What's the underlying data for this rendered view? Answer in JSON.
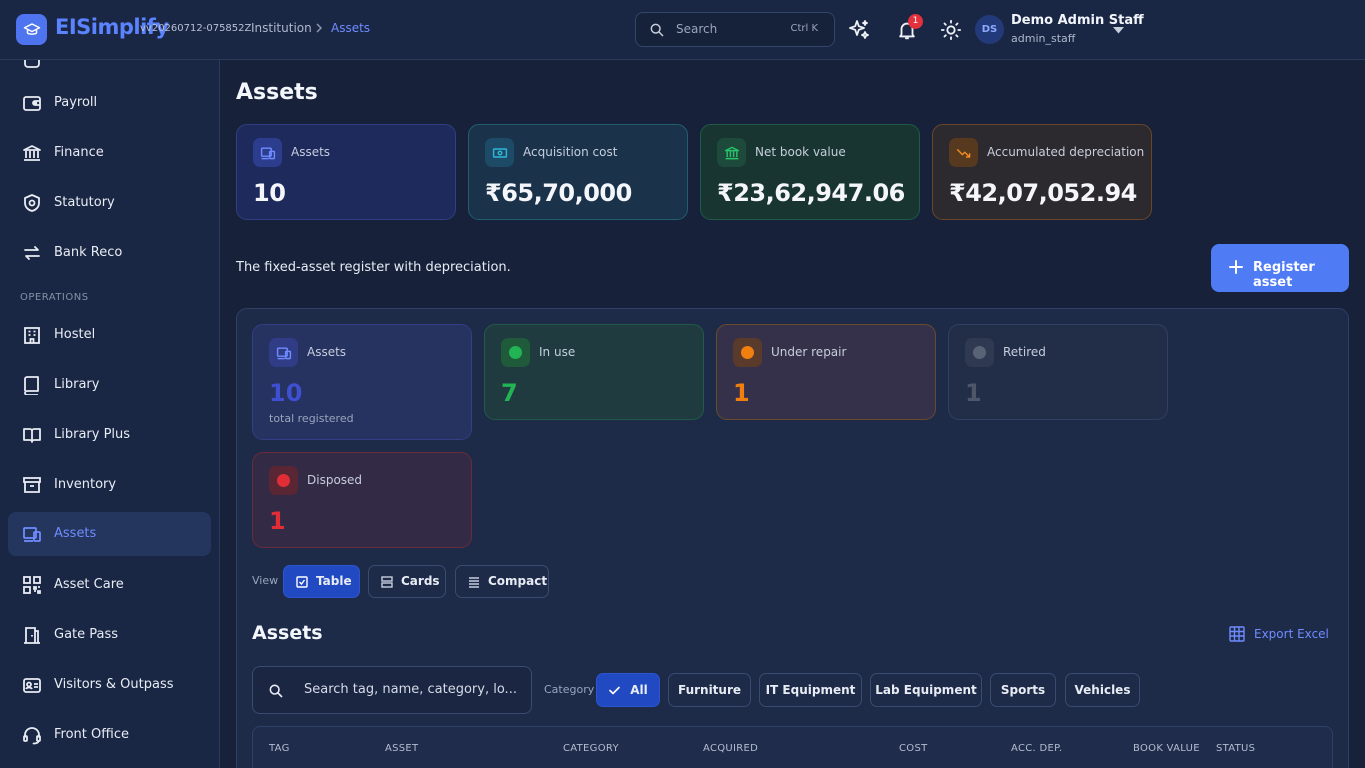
{
  "header": {
    "brand": "EISimplify",
    "version": "vv20260712-075852Z",
    "breadcrumb": [
      "Institution",
      "Assets"
    ],
    "search": {
      "placeholder": "Search",
      "shortcut": "Ctrl K"
    },
    "notifications": {
      "count": "1"
    },
    "user": {
      "initials": "DS",
      "name": "Demo Admin Staff",
      "role": "admin_staff"
    },
    "colors": {
      "brand": "#5b83ff",
      "accent": "#4f7cf5",
      "badge": "#e3303d"
    }
  },
  "sidebar": {
    "section_label": "OPERATIONS",
    "items": [
      {
        "label": "Payroll",
        "icon": "wallet-icon"
      },
      {
        "label": "Finance",
        "icon": "bank-icon"
      },
      {
        "label": "Statutory",
        "icon": "shield-icon"
      },
      {
        "label": "Bank Reco",
        "icon": "arrows-swap-icon"
      },
      {
        "label": "Hostel",
        "icon": "building-icon"
      },
      {
        "label": "Library",
        "icon": "book-icon"
      },
      {
        "label": "Library Plus",
        "icon": "open-book-icon"
      },
      {
        "label": "Inventory",
        "icon": "archive-box-icon"
      },
      {
        "label": "Assets",
        "icon": "devices-icon",
        "active": true
      },
      {
        "label": "Asset Care",
        "icon": "qr-code-icon"
      },
      {
        "label": "Gate Pass",
        "icon": "gate-icon"
      },
      {
        "label": "Visitors & Outpass",
        "icon": "id-card-icon"
      },
      {
        "label": "Front Office",
        "icon": "headset-icon"
      }
    ]
  },
  "main": {
    "title": "Assets",
    "kpis": [
      {
        "label": "Assets",
        "value": "10",
        "icon": "devices-icon"
      },
      {
        "label": "Acquisition cost",
        "value": "₹65,70,000",
        "icon": "cash-icon"
      },
      {
        "label": "Net book value",
        "value": "₹23,62,947.06",
        "icon": "bank-icon"
      },
      {
        "label": "Accumulated depreciation",
        "value": "₹42,07,052.94",
        "icon": "trend-down-icon"
      }
    ],
    "subtitle": "The fixed-asset register with depreciation.",
    "register_button": "Register asset",
    "status_cards": {
      "assets": {
        "label": "Assets",
        "value": "10",
        "sub": "total registered",
        "color": "#3f4fd1"
      },
      "in_use": {
        "label": "In use",
        "value": "7",
        "color": "#22b454"
      },
      "under_repair": {
        "label": "Under repair",
        "value": "1",
        "color": "#f07f0f"
      },
      "retired": {
        "label": "Retired",
        "value": "1",
        "color": "#6b7385"
      },
      "disposed": {
        "label": "Disposed",
        "value": "1",
        "color": "#e02d36"
      }
    },
    "view": {
      "label": "View",
      "options": [
        "Table",
        "Cards",
        "Compact"
      ],
      "selected": "Table"
    },
    "table_section": {
      "title": "Assets",
      "export_label": "Export Excel",
      "search_placeholder": "Search tag, name, category, lo...",
      "category_label": "Category",
      "categories": [
        "All",
        "Furniture",
        "IT Equipment",
        "Lab Equipment",
        "Sports",
        "Vehicles"
      ],
      "selected_category": "All",
      "columns": [
        "TAG",
        "ASSET",
        "CATEGORY",
        "ACQUIRED",
        "COST",
        "ACC. DEP.",
        "BOOK VALUE",
        "STATUS"
      ]
    }
  }
}
